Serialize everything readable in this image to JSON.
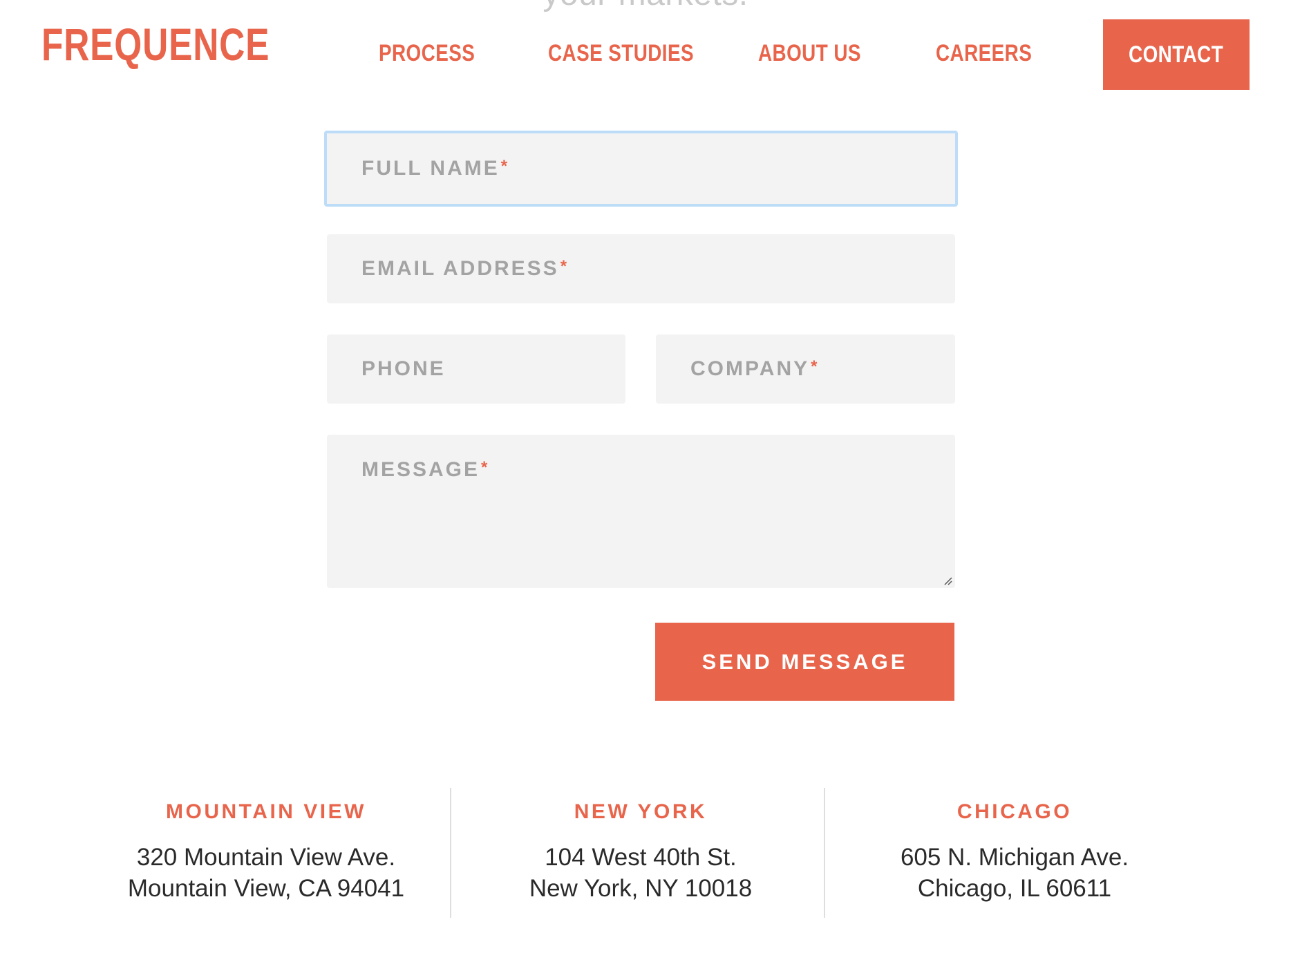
{
  "header": {
    "tagline_fragment": "your markets.",
    "logo": "FREQUENCE",
    "nav": [
      {
        "label": "PROCESS"
      },
      {
        "label": "CASE STUDIES"
      },
      {
        "label": "ABOUT US"
      },
      {
        "label": "CAREERS"
      }
    ],
    "contact_label": "CONTACT"
  },
  "form": {
    "full_name": {
      "placeholder": "FULL NAME",
      "required_mark": "*",
      "value": ""
    },
    "email": {
      "placeholder": "EMAIL ADDRESS",
      "required_mark": "*",
      "value": ""
    },
    "phone": {
      "placeholder": "PHONE",
      "value": ""
    },
    "company": {
      "placeholder": "COMPANY",
      "required_mark": "*",
      "value": ""
    },
    "message": {
      "placeholder": "MESSAGE",
      "required_mark": "*",
      "value": ""
    },
    "submit_label": "SEND MESSAGE"
  },
  "offices": [
    {
      "city": "MOUNTAIN VIEW",
      "line1": "320 Mountain View Ave.",
      "line2": "Mountain View, CA 94041"
    },
    {
      "city": "NEW YORK",
      "line1": "104 West 40th St.",
      "line2": "New York, NY 10018"
    },
    {
      "city": "CHICAGO",
      "line1": "605 N. Michigan Ave.",
      "line2": "Chicago, IL 60611"
    }
  ],
  "colors": {
    "accent": "#e8654c",
    "field_bg": "#f3f3f3",
    "focus_border": "#bcdcf8",
    "placeholder": "#a3a3a3"
  }
}
